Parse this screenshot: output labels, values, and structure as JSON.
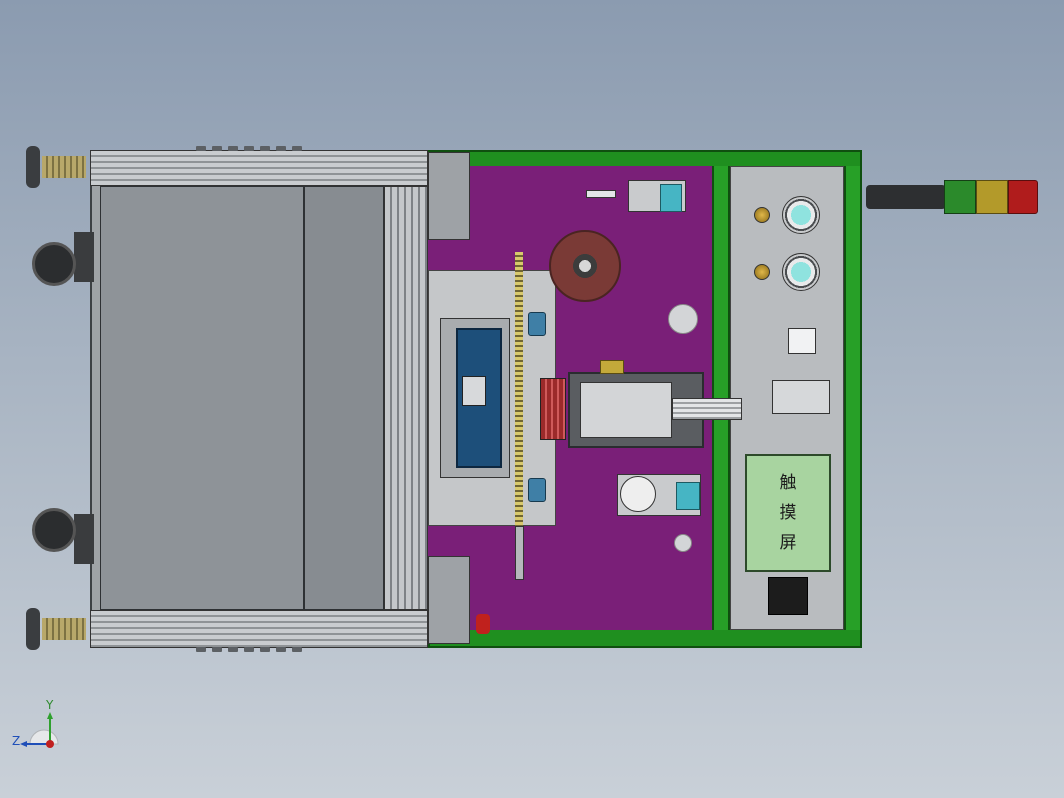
{
  "touch_screen": {
    "char1": "触",
    "char2": "摸",
    "char3": "屏"
  },
  "triad": {
    "y_label": "Y",
    "z_label": "Z"
  },
  "colors": {
    "background": "#9aa8b8",
    "base_plate": "#7a1f78",
    "frame_green": "#1f8f1f",
    "frame_grey": "#9fa3a6",
    "light_green": "#2b8a2b",
    "light_yellow": "#b39a2a",
    "light_red": "#b01c1c"
  }
}
